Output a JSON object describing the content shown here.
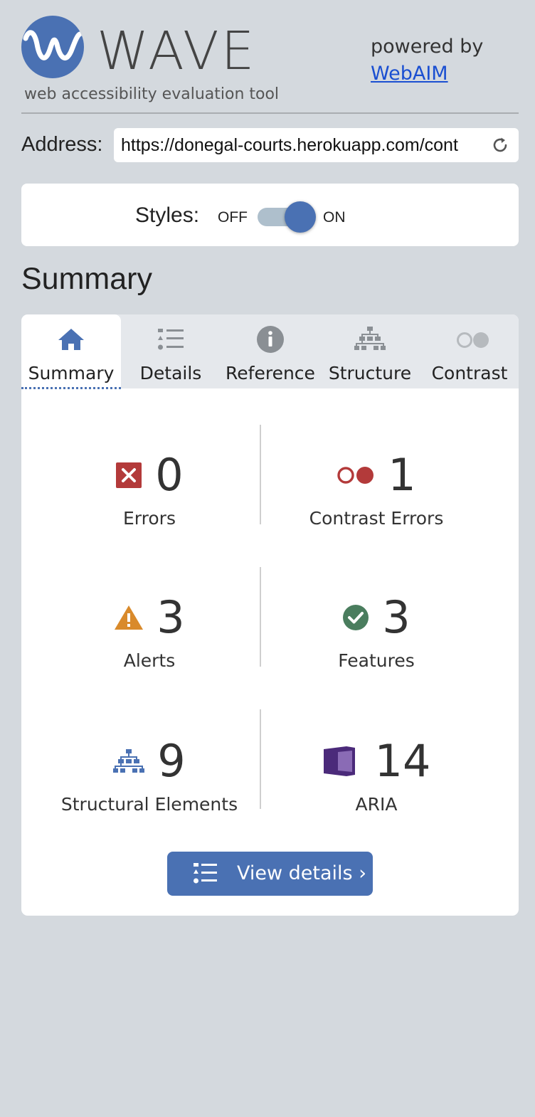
{
  "header": {
    "logo_word": "WAVE",
    "tagline": "web accessibility evaluation tool",
    "powered_by": "powered by",
    "webaim_link": "WebAIM"
  },
  "address": {
    "label": "Address:",
    "value": "https://donegal-courts.herokuapp.com/cont"
  },
  "styles": {
    "label": "Styles:",
    "off_label": "OFF",
    "on_label": "ON",
    "state": "on"
  },
  "summary_heading": "Summary",
  "tabs": [
    {
      "label": "Summary",
      "icon": "home-icon",
      "active": true
    },
    {
      "label": "Details",
      "icon": "list-icon",
      "active": false
    },
    {
      "label": "Reference",
      "icon": "info-icon",
      "active": false
    },
    {
      "label": "Structure",
      "icon": "hierarchy-icon",
      "active": false
    },
    {
      "label": "Contrast",
      "icon": "contrast-icon",
      "active": false
    }
  ],
  "stats": {
    "errors": {
      "count": "0",
      "label": "Errors",
      "icon": "error-icon"
    },
    "contrast_errors": {
      "count": "1",
      "label": "Contrast Errors",
      "icon": "contrast-error-icon"
    },
    "alerts": {
      "count": "3",
      "label": "Alerts",
      "icon": "alert-icon"
    },
    "features": {
      "count": "3",
      "label": "Features",
      "icon": "feature-check-icon"
    },
    "structural": {
      "count": "9",
      "label": "Structural Elements",
      "icon": "structure-icon"
    },
    "aria": {
      "count": "14",
      "label": "ARIA",
      "icon": "aria-icon"
    }
  },
  "view_details_label": "View details ›",
  "colors": {
    "accent": "#4a71b3",
    "error": "#b33a3a",
    "alert": "#d98a2b",
    "feature": "#4a7d5e",
    "aria": "#4b2a7a",
    "link": "#1a4fd1",
    "background": "#d4d9de"
  }
}
